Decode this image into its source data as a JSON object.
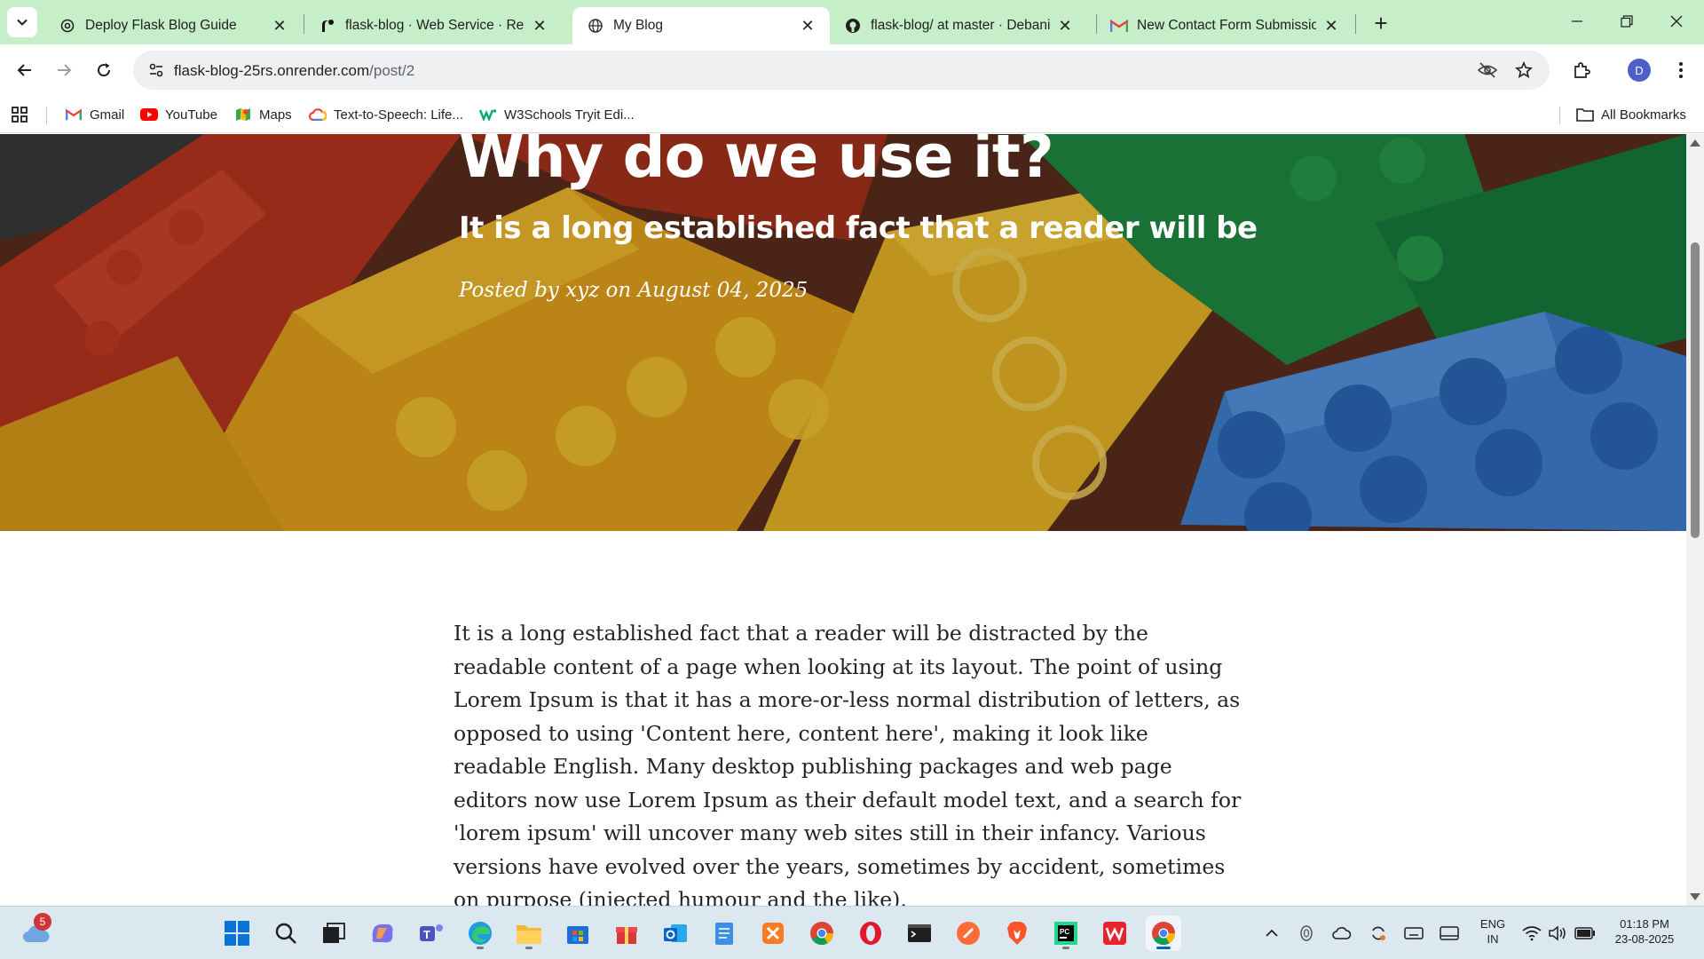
{
  "browser": {
    "tabs": [
      {
        "title": "Deploy Flask Blog Guide",
        "favicon": "openai-icon",
        "active": false
      },
      {
        "title": "flask-blog · Web Service · Render",
        "favicon": "render-icon",
        "active": false
      },
      {
        "title": "My Blog",
        "favicon": "globe-icon",
        "active": true
      },
      {
        "title": "flask-blog/ at master · DebanilB",
        "favicon": "github-icon",
        "active": false
      },
      {
        "title": "New Contact Form Submission",
        "favicon": "gmail-icon",
        "active": false
      }
    ],
    "address": {
      "host": "flask-blog-25rs.onrender.com",
      "path": "/post/2"
    },
    "profile_initial": "D",
    "bookmarks": [
      {
        "label": "Gmail",
        "icon": "gmail-icon"
      },
      {
        "label": "YouTube",
        "icon": "youtube-icon"
      },
      {
        "label": "Maps",
        "icon": "maps-icon"
      },
      {
        "label": "Text-to-Speech: Life...",
        "icon": "cloud-icon"
      },
      {
        "label": "W3Schools Tryit Edi...",
        "icon": "w3schools-icon"
      }
    ],
    "all_bookmarks_label": "All Bookmarks"
  },
  "page": {
    "heading": "Why do we use it?",
    "subheading": "It is a long established fact that a reader will be",
    "meta": "Posted by xyz on August 04, 2025",
    "body": "It is a long established fact that a reader will be distracted by the readable content of a page when looking at its layout. The point of using Lorem Ipsum is that it has a more-or-less normal distribution of letters, as opposed to using 'Content here, content here', making it look like readable English. Many desktop publishing packages and web page editors now use Lorem Ipsum as their default model text, and a search for 'lorem ipsum' will uncover many web sites still in their infancy. Various versions have evolved over the years, sometimes by accident, sometimes on purpose (injected humour and the like)."
  },
  "taskbar": {
    "weather_badge": "5",
    "language": "ENG",
    "region": "IN",
    "time": "01:18 PM",
    "date": "23-08-2025",
    "apps": [
      "start-icon",
      "search-icon",
      "task-view-icon",
      "copilot-icon",
      "teams-icon",
      "edge-icon",
      "file-explorer-icon",
      "microsoft-store-icon",
      "gift-icon",
      "outlook-icon",
      "notepad-icon",
      "xampp-icon",
      "chrome-icon",
      "opera-icon",
      "terminal-icon",
      "postman-icon",
      "brave-icon",
      "pycharm-icon",
      "wps-icon",
      "chrome-active-icon"
    ]
  },
  "colors": {
    "tabstrip_bg": "#c5eec9",
    "omnibox_bg": "#eef0f1",
    "taskbar_bg": "#dbe8f0",
    "body_text": "#212529"
  }
}
